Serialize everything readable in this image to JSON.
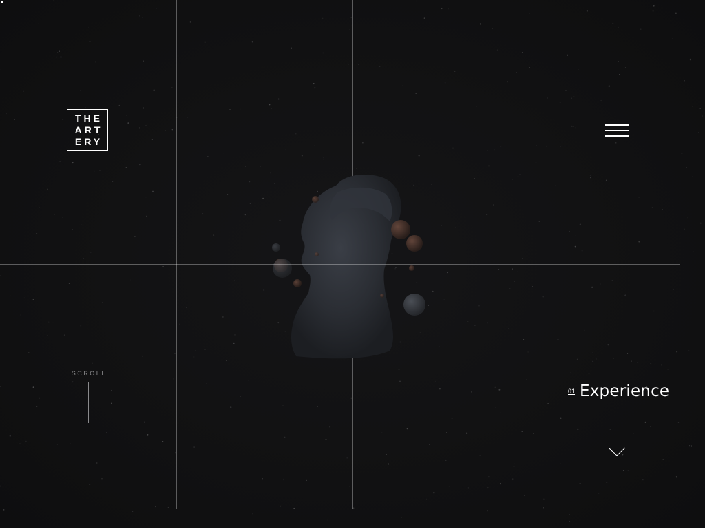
{
  "brand": {
    "logo_lines": [
      "THE",
      "ART",
      "ERY"
    ]
  },
  "menu": {
    "icon": "hamburger-menu-icon"
  },
  "scroll": {
    "label": "SCROLL"
  },
  "section": {
    "index": "01",
    "title": "Experience"
  },
  "navigation": {
    "next_icon": "chevron-down-icon"
  },
  "colors": {
    "background": "#111112",
    "foreground": "#ffffff",
    "muted": "#8a8a8c",
    "grid": "rgba(255,255,255,0.32)"
  }
}
